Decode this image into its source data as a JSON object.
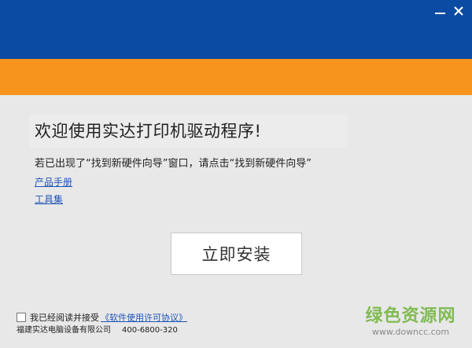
{
  "window": {
    "minimize_label": "minimize",
    "close_label": "close"
  },
  "main": {
    "welcome": "欢迎使用实达打印机驱动程序!",
    "instruction": "若已出现了“找到新硬件向导”窗口，请点击“找到新硬件向导”",
    "links": {
      "manual": "产品手册",
      "tools": "工具集"
    },
    "install_button": "立即安装"
  },
  "footer": {
    "agree_text": "我已经阅读并接受",
    "license_link": "《软件使用许可协议》",
    "company": "福建实达电脑设备有限公司",
    "phone": "400-6800-320"
  },
  "watermark": {
    "title": "绿色资源网",
    "url": "www.downcc.com"
  },
  "colors": {
    "header_blue": "#0b4ba3",
    "header_orange": "#f7941e",
    "link_blue": "#1d55b8",
    "background": "#e8e8e8"
  },
  "icons": {
    "minimize": "minimize-icon",
    "close": "close-icon"
  }
}
